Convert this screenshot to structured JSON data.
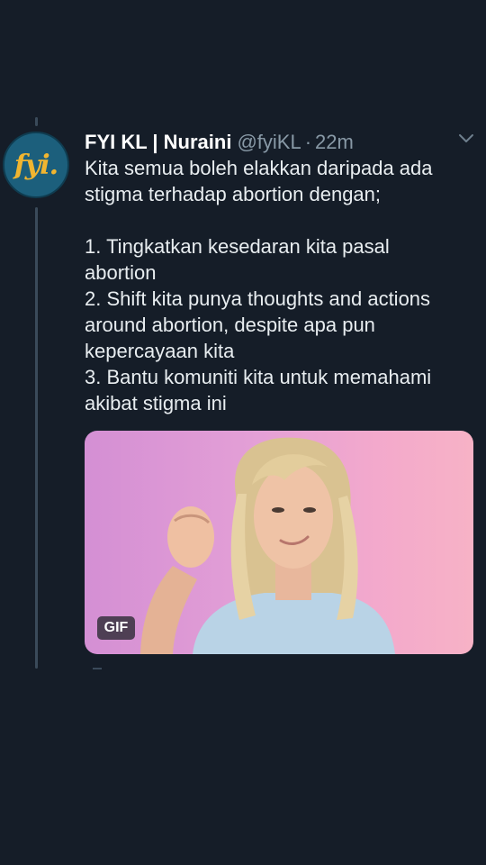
{
  "tweet": {
    "avatar_text": "fyi.",
    "display_name": "FYI KL | Nuraini",
    "handle": "@fyiKL",
    "separator": "·",
    "time": "22m",
    "lines": [
      "Kita semua boleh elakkan daripada ada",
      "stigma terhadap abortion dengan;",
      "",
      "1. Tingkatkan kesedaran kita pasal",
      "abortion",
      "2. Shift kita punya thoughts and actions",
      "around abortion, despite apa pun",
      "kepercayaan kita",
      "3. Bantu komuniti kita untuk memahami",
      "akibat stigma ini"
    ],
    "media": {
      "badge": "GIF"
    }
  },
  "icons": {
    "chevron": "chevron-down-icon"
  },
  "colors": {
    "background": "#151d28",
    "avatar": "#1c5f7c",
    "avatar_text": "#f0b530",
    "muted_text": "#8899a6"
  }
}
